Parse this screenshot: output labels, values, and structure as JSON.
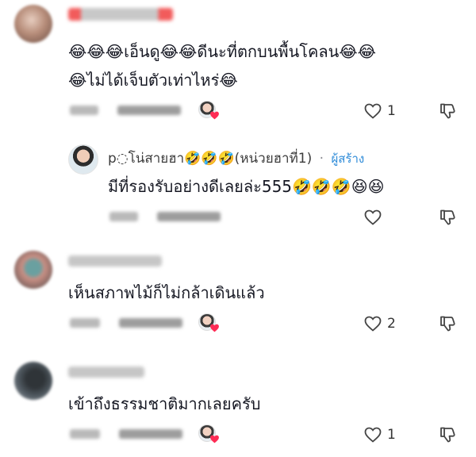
{
  "comments": [
    {
      "text_line1": "😂😂😂เอ็นดู😂😂ดีนะที่ตกบนพื้นโคลน😂😂",
      "text_line2": "😂ไม่ได้เจ็บตัวเท่าไหร่😂",
      "like_count": "1",
      "liked_by_creator": true
    },
    {
      "text_line1": "เห็นสภาพไม้ก็ไม่กล้าเดินแล้ว",
      "like_count": "2",
      "liked_by_creator": true
    },
    {
      "text_line1": "เข้าถึงธรรมชาติมากเลยครับ",
      "like_count": "1",
      "liked_by_creator": true
    }
  ],
  "reply": {
    "author": "p◌โน่สายฮา🤣🤣🤣(หน่วยฮาที่1)",
    "separator": "·",
    "creator_label": "ผู้สร้าง",
    "text": "มีที่รองรับอย่างดีเลยล่ะ555🤣🤣🤣😆😆",
    "like_count": ""
  },
  "icons": {
    "like": "heart-outline-icon",
    "dislike": "thumbs-down-icon",
    "creator_liked": "heart-filled-icon"
  },
  "colors": {
    "creator_link": "#2e8bd8",
    "heart_red": "#fe2c55",
    "text": "#161823"
  }
}
